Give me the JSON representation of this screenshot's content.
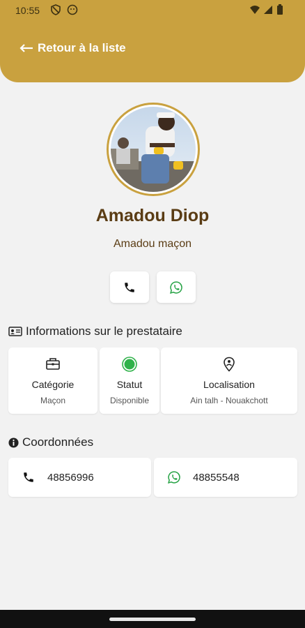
{
  "status_bar": {
    "time": "10:55"
  },
  "header": {
    "back_label": "Retour à la liste"
  },
  "profile": {
    "name": "Amadou Diop",
    "subtitle": "Amadou maçon"
  },
  "info_section": {
    "title": "Informations sur le prestataire",
    "cards": [
      {
        "label": "Catégorie",
        "value": "Maçon",
        "icon": "toolbox-icon"
      },
      {
        "label": "Statut",
        "value": "Disponible",
        "icon": "status-dot-icon"
      },
      {
        "label": "Localisation",
        "value": "Ain talh - Nouakchott",
        "icon": "location-pin-icon"
      }
    ]
  },
  "contact_section": {
    "title": "Coordonnées",
    "phone": "48856996",
    "whatsapp": "48855548"
  },
  "colors": {
    "primary": "#c9a13f",
    "name_text": "#5a3c14",
    "whatsapp": "#25a244",
    "status_available": "#2fb24a"
  }
}
